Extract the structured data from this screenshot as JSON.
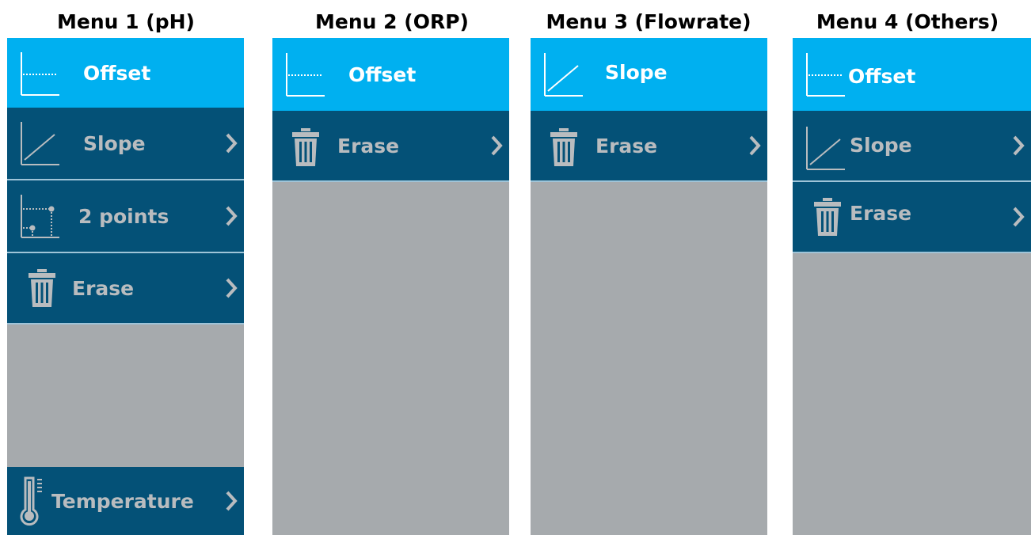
{
  "menus": [
    {
      "title": "Menu 1 (pH)",
      "items": [
        {
          "label": "Offset",
          "icon": "offset-graph-icon",
          "active": true
        },
        {
          "label": "Slope",
          "icon": "slope-graph-icon"
        },
        {
          "label": "2 points",
          "icon": "two-points-graph-icon"
        },
        {
          "label": "Erase",
          "icon": "trash-icon"
        },
        {
          "label": "Temperature",
          "icon": "thermometer-icon"
        }
      ]
    },
    {
      "title": "Menu 2 (ORP)",
      "items": [
        {
          "label": "Offset",
          "icon": "offset-graph-icon",
          "active": true
        },
        {
          "label": "Erase",
          "icon": "trash-icon"
        }
      ]
    },
    {
      "title": "Menu 3 (Flowrate)",
      "items": [
        {
          "label": "Slope",
          "icon": "slope-graph-icon",
          "active": true
        },
        {
          "label": "Erase",
          "icon": "trash-icon"
        }
      ]
    },
    {
      "title": "Menu 4 (Others)",
      "items": [
        {
          "label": "Offset",
          "icon": "offset-graph-icon",
          "active": true
        },
        {
          "label": "Slope",
          "icon": "slope-graph-icon"
        },
        {
          "label": "Erase",
          "icon": "trash-icon"
        }
      ]
    }
  ],
  "colors": {
    "active_bg": "#00b0f0",
    "item_bg": "#045177",
    "panel_bg": "#a6aaad",
    "divider": "#9fc4d8"
  }
}
